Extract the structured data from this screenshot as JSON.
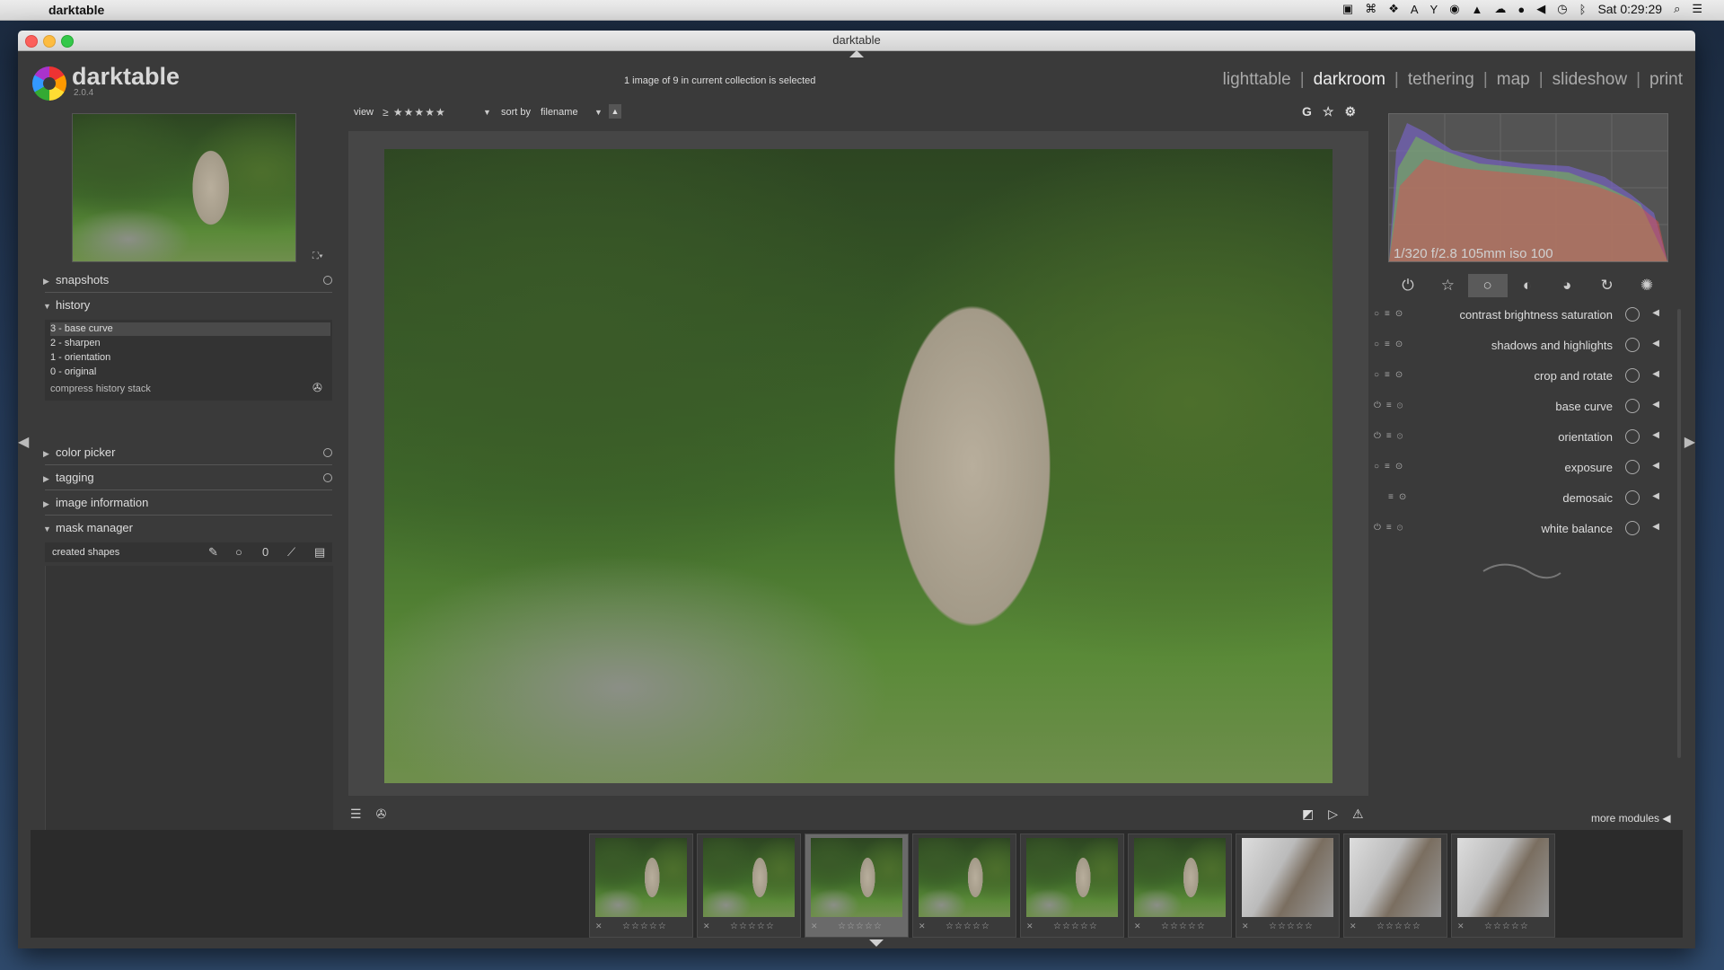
{
  "menubar": {
    "app_name": "darktable",
    "clock": "Sat 0:29:29"
  },
  "window": {
    "title": "darktable"
  },
  "header": {
    "logo_text": "darktable",
    "version": "2.0.4",
    "collection_status": "1 image of 9 in current collection is selected",
    "views": [
      "lighttable",
      "darkroom",
      "tethering",
      "map",
      "slideshow",
      "print"
    ],
    "active_view": "darkroom"
  },
  "left_panel": {
    "snapshots": "snapshots",
    "history": "history",
    "history_items": [
      "3 - base curve",
      "2 - sharpen",
      "1 - orientation",
      "0 - original"
    ],
    "compress": "compress history stack",
    "color_picker": "color picker",
    "tagging": "tagging",
    "image_information": "image information",
    "mask_manager": "mask manager",
    "created_shapes": "created shapes"
  },
  "center": {
    "view_label": "view",
    "rating_filter": "≥ ★★★★★",
    "sort_label": "sort by",
    "sort_value": "filename",
    "group_button": "G"
  },
  "right_panel": {
    "exif": "1/320 f/2.8 105mm iso 100",
    "modules": [
      "contrast brightness saturation",
      "shadows and highlights",
      "crop and rotate",
      "base curve",
      "orientation",
      "exposure",
      "demosaic",
      "white balance"
    ],
    "more_modules": "more modules"
  },
  "filmstrip": {
    "count": 9,
    "selected_index": 2,
    "stars": "☆☆☆☆☆"
  },
  "colors": {
    "panel_bg": "#3a3a3a",
    "active_text": "#eeeeee",
    "inactive_text": "#aaaaaa"
  }
}
